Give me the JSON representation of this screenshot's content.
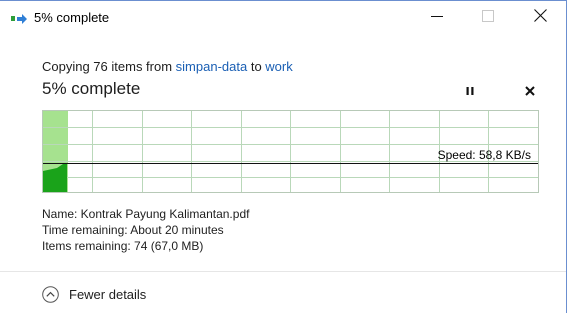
{
  "window": {
    "title": "5% complete",
    "icon": "file-copy-icon",
    "controls": {
      "minimize": "minimize-icon",
      "maximize": "maximize-icon",
      "close": "close-icon"
    }
  },
  "operation": {
    "prefix": "Copying 76 items from ",
    "source": "simpan-data",
    "middle": " to ",
    "destination": "work",
    "progress_text": "5% complete",
    "progress_fraction": 0.05,
    "pause_icon": "pause-icon",
    "cancel_icon": "cancel-icon"
  },
  "graph": {
    "speed_label": "Speed: 58,8 KB/s",
    "fill_color": "#a6e28f",
    "speed_color": "#1aa31a"
  },
  "details": {
    "name": "Name: Kontrak Payung Kalimantan.pdf",
    "time_remaining": "Time remaining: About 20 minutes",
    "items_remaining": "Items remaining: 74 (67,0 MB)"
  },
  "footer": {
    "toggle_label": "Fewer details",
    "toggle_icon": "chevron-up-icon"
  }
}
